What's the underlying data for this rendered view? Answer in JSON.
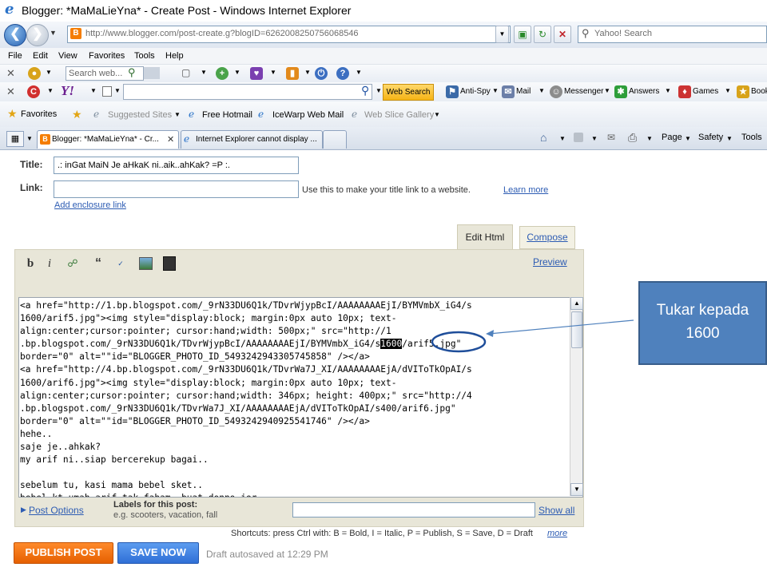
{
  "window": {
    "title": "Blogger: *MaMaLieYna* - Create Post - Windows Internet Explorer"
  },
  "addressbar": {
    "url": "http://www.blogger.com/post-create.g?blogID=6262008250756068546",
    "search_placeholder": "Yahoo! Search"
  },
  "menubar": {
    "items": [
      "File",
      "Edit",
      "View",
      "Favorites",
      "Tools",
      "Help"
    ]
  },
  "toolbar1": {
    "search_placeholder": "Search web..."
  },
  "toolbar2": {
    "web_search": "Web Search",
    "anti_spy": "Anti-Spy",
    "mail": "Mail",
    "messenger": "Messenger",
    "answers": "Answers",
    "games": "Games",
    "bookmarks": "Book"
  },
  "favbar": {
    "favorites": "Favorites",
    "items": [
      "Suggested Sites",
      "Free Hotmail",
      "IceWarp Web Mail",
      "Web Slice Gallery"
    ]
  },
  "tabs": {
    "items": [
      "Blogger: *MaMaLieYna* - Cr...",
      "Internet Explorer cannot display ..."
    ],
    "page_menu": "Page",
    "safety_menu": "Safety",
    "tools_menu": "Tools"
  },
  "post": {
    "title_label": "Title:",
    "title_value": ".: inGat MaiN Je aHkaK ni..aik..ahKak? =P :.",
    "link_label": "Link:",
    "link_help": "Use this to make your title link to a website.",
    "learn_more": "Learn more",
    "add_enclosure": "Add enclosure link",
    "tab_edit_html": "Edit Html",
    "tab_compose": "Compose",
    "preview": "Preview",
    "html_before_highlight": "<a href=\"http://1.bp.blogspot.com/_9rN33DU6Q1k/TDvrWjypBcI/AAAAAAAAEjI/BYMVmbX_iG4/s\n1600/arif5.jpg\"><img style=\"display:block; margin:0px auto 10px; text-\nalign:center;cursor:pointer; cursor:hand;width: 500px;\" src=\"http://1\n.bp.blogspot.com/_9rN33DU6Q1k/TDvrWjypBcI/AAAAAAAAEjI/BYMVmbX_iG4/s",
    "html_highlight": "1600",
    "html_after_highlight": "/arif5.jpg\"\nborder=\"0\" alt=\"\"id=\"BLOGGER_PHOTO_ID_5493242943305745858\" /></a>\n<a href=\"http://4.bp.blogspot.com/_9rN33DU6Q1k/TDvrWa7J_XI/AAAAAAAAEjA/dVIToTkOpAI/s\n1600/arif6.jpg\"><img style=\"display:block; margin:0px auto 10px; text-\nalign:center;cursor:pointer; cursor:hand;width: 346px; height: 400px;\" src=\"http://4\n.bp.blogspot.com/_9rN33DU6Q1k/TDvrWa7J_XI/AAAAAAAAEjA/dVIToTkOpAI/s400/arif6.jpg\"\nborder=\"0\" alt=\"\"id=\"BLOGGER_PHOTO_ID_5493242940925541746\" /></a>\nhehe..\nsaje je..ahkak?\nmy arif ni..siap bercerekup bagai..\n\nsebelum tu, kasi mama bebel sket..\nbebel kt umah arif tak faham..buat donno jer..",
    "post_options": "Post Options",
    "labels_title": "Labels for this post:",
    "labels_hint": "e.g. scooters, vacation, fall",
    "show_all": "Show all",
    "shortcuts": "Shortcuts: press Ctrl with: B = Bold, I = Italic, P = Publish, S = Save, D = Draft",
    "shortcuts_more": "more",
    "publish": "PUBLISH POST",
    "save": "SAVE NOW",
    "autosave": "Draft autosaved at 12:29 PM"
  },
  "callout": {
    "line1": "Tukar kepada",
    "line2": "1600"
  },
  "colors": {
    "callout_fill": "#4f81bd",
    "publish_orange": "#f57d00",
    "save_blue": "#3b7ddd",
    "link_blue": "#2d5cb3",
    "highlight_ring": "#1f4e9a"
  }
}
